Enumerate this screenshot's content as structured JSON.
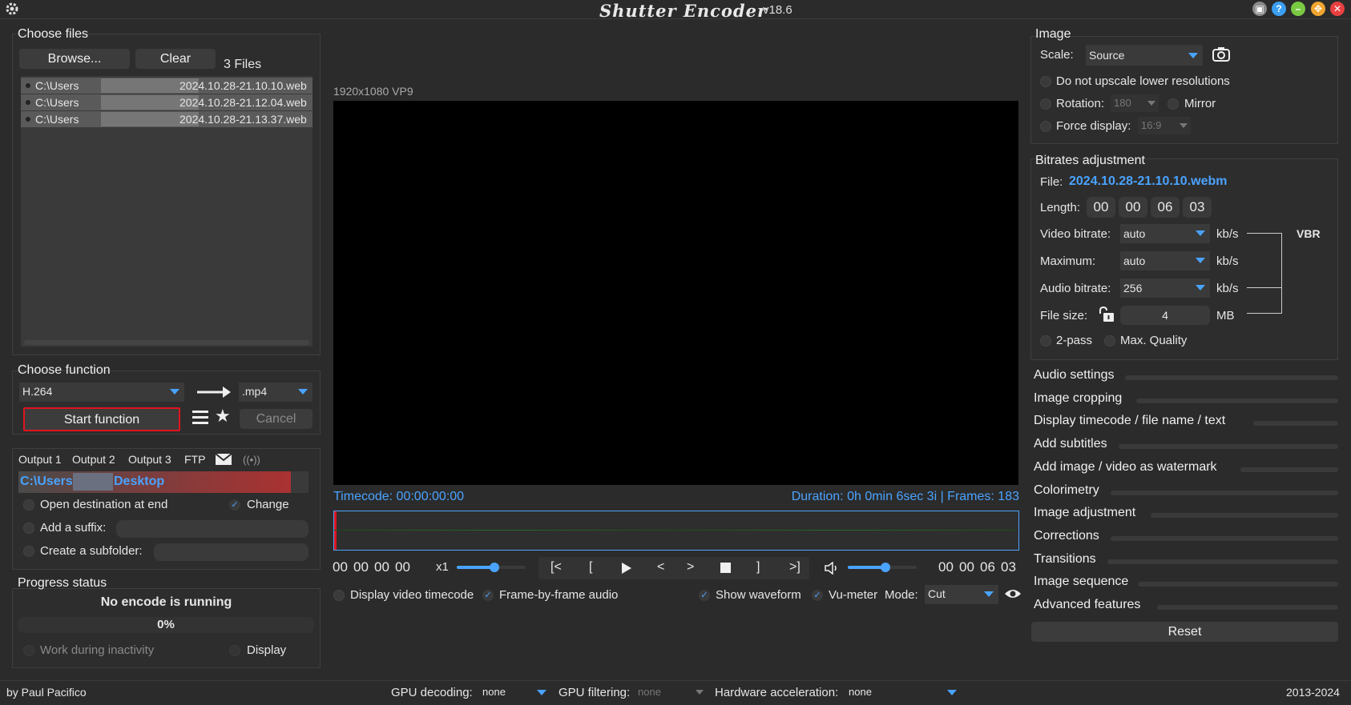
{
  "app": {
    "title": "Shutter Encoder",
    "version": "v18.6"
  },
  "window_buttons": [
    "compact-icon",
    "help-icon",
    "minimize-icon",
    "maximize-icon",
    "close-icon"
  ],
  "choose_files": {
    "title": "Choose files",
    "browse_label": "Browse...",
    "clear_label": "Clear",
    "count_label": "3 Files",
    "files": [
      {
        "prefix": "C:\\Users",
        "suffix": "2024.10.28-21.10.10.web"
      },
      {
        "prefix": "C:\\Users",
        "suffix": "2024.10.28-21.12.04.web"
      },
      {
        "prefix": "C:\\Users",
        "suffix": "2024.10.28-21.13.37.web"
      }
    ]
  },
  "choose_function": {
    "title": "Choose function",
    "function_value": "H.264",
    "extension_value": ".mp4",
    "start_label": "Start function",
    "cancel_label": "Cancel"
  },
  "output": {
    "tabs": [
      "Output 1",
      "Output 2",
      "Output 3",
      "FTP"
    ],
    "destination_prefix": "C:\\Users",
    "destination_suffix": "Desktop",
    "open_destination_label": "Open destination at end",
    "change_label": "Change",
    "suffix_label": "Add a suffix:",
    "subfolder_label": "Create a subfolder:"
  },
  "progress": {
    "title": "Progress status",
    "status_text": "No encode is running",
    "percent": "0%",
    "work_inactivity_label": "Work during inactivity",
    "display_label": "Display"
  },
  "player": {
    "video_info": "1920x1080 VP9",
    "timecode_text": "Timecode: 00:00:00:00",
    "duration_text": "Duration: 0h 0min 6sec 3i | Frames: 183",
    "current_tc": [
      "00",
      "00",
      "00",
      "00"
    ],
    "speed_label": "x1",
    "speed_level": 0.55,
    "controls": [
      "[<",
      "[",
      "play",
      "<",
      ">",
      "stop",
      "]",
      ">]"
    ],
    "volume_level": 0.55,
    "end_tc": [
      "00",
      "00",
      "06",
      "03"
    ],
    "display_timecode_label": "Display video timecode",
    "frame_audio_label": "Frame-by-frame audio",
    "show_waveform_label": "Show waveform",
    "vumeter_label": "Vu-meter",
    "mode_label": "Mode:",
    "mode_value": "Cut"
  },
  "image": {
    "title": "Image",
    "scale_label": "Scale:",
    "scale_value": "Source",
    "upscale_label": "Do not upscale lower resolutions",
    "rotation_label": "Rotation:",
    "rotation_value": "180",
    "mirror_label": "Mirror",
    "force_display_label": "Force display:",
    "force_display_value": "16:9"
  },
  "bitrates": {
    "title": "Bitrates adjustment",
    "file_label": "File:",
    "file_value": "2024.10.28-21.10.10.webm",
    "length_label": "Length:",
    "length_values": [
      "00",
      "00",
      "06",
      "03"
    ],
    "video_bitrate_label": "Video bitrate:",
    "video_bitrate_value": "auto",
    "maximum_label": "Maximum:",
    "maximum_value": "auto",
    "audio_bitrate_label": "Audio bitrate:",
    "audio_bitrate_value": "256",
    "unit_kbs": "kb/s",
    "file_size_label": "File size:",
    "file_size_value": "4",
    "unit_mb": "MB",
    "vbr_label": "VBR",
    "two_pass_label": "2-pass",
    "max_quality_label": "Max. Quality"
  },
  "sections": [
    "Audio settings",
    "Image cropping",
    "Display timecode / file name / text",
    "Add subtitles",
    "Add image / video as watermark",
    "Colorimetry",
    "Image adjustment",
    "Corrections",
    "Transitions",
    "Image sequence",
    "Advanced features"
  ],
  "reset_label": "Reset",
  "footer": {
    "author": "by Paul Pacifico",
    "gpu_decoding_label": "GPU decoding:",
    "gpu_decoding_value": "none",
    "gpu_filtering_label": "GPU filtering:",
    "gpu_filtering_value": "none",
    "hw_accel_label": "Hardware acceleration:",
    "hw_accel_value": "none",
    "years": "2013-2024"
  },
  "colors": {
    "accent_blue": "#4aa3ff",
    "highlight_red": "#e0141e",
    "destination_gradient_end": "#b03030"
  }
}
